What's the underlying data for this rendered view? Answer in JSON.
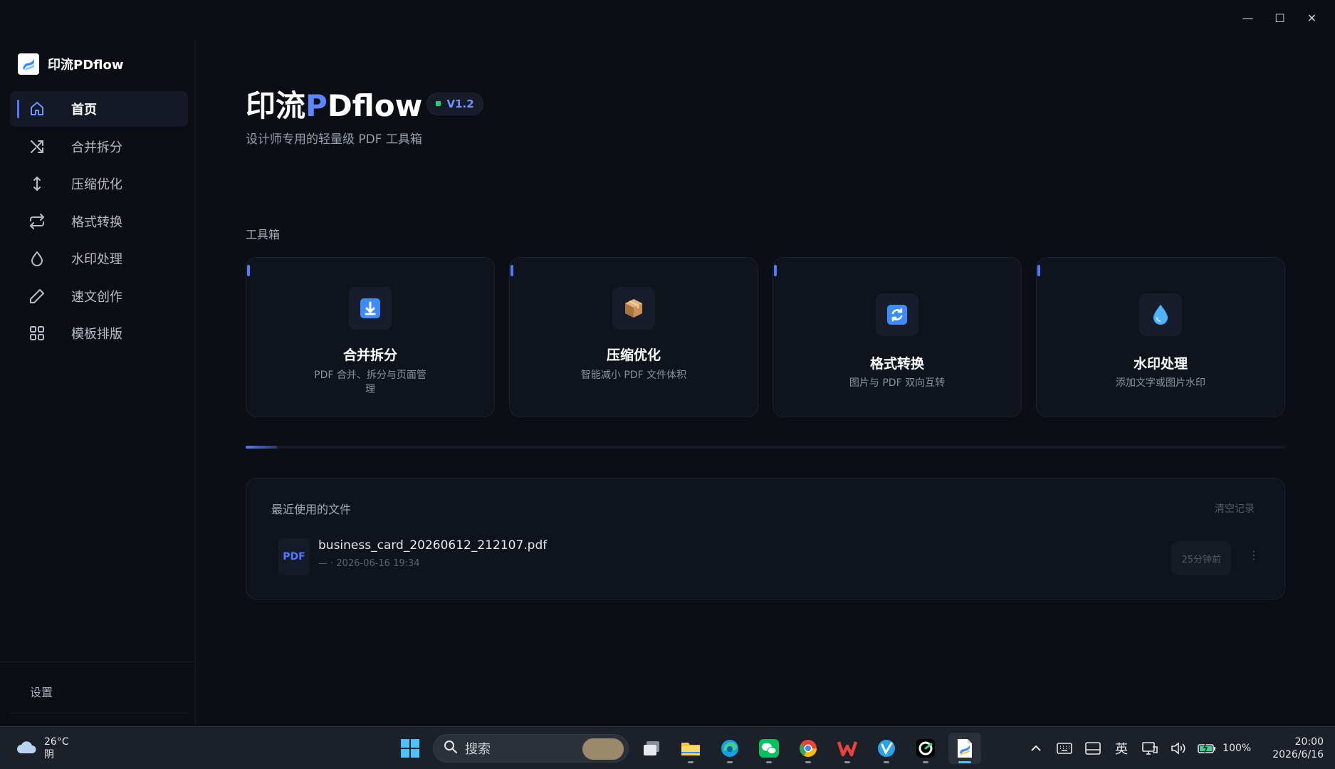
{
  "window": {
    "minimize": "—",
    "maximize": "☐",
    "close": "✕"
  },
  "sidebar": {
    "brand": "印流PDflow",
    "items": [
      {
        "label": "首页",
        "icon": "home-icon",
        "active": true
      },
      {
        "label": "合并拆分",
        "icon": "shuffle-icon"
      },
      {
        "label": "压缩优化",
        "icon": "updown-arrow-icon"
      },
      {
        "label": "格式转换",
        "icon": "repeat-icon"
      },
      {
        "label": "水印处理",
        "icon": "droplet-icon"
      },
      {
        "label": "速文创作",
        "icon": "pencil-icon"
      },
      {
        "label": "模板排版",
        "icon": "grid-icon"
      }
    ],
    "settings": "设置"
  },
  "header": {
    "title_part1": "印流",
    "title_accent": "P",
    "title_part2": "Dflow",
    "version": "V1.2",
    "subtitle": "设计师专用的轻量级 PDF 工具箱"
  },
  "toolbox": {
    "label": "工具箱",
    "cards": [
      {
        "title": "合并拆分",
        "desc": "PDF 合并、拆分与页面管理",
        "icon": "download-box-icon"
      },
      {
        "title": "压缩优化",
        "desc": "智能减小 PDF 文件体积",
        "icon": "package-icon"
      },
      {
        "title": "格式转换",
        "desc": "图片与 PDF 双向互转",
        "icon": "refresh-icon"
      },
      {
        "title": "水印处理",
        "desc": "添加文字或图片水印",
        "icon": "droplet-icon"
      }
    ]
  },
  "progress": {
    "fraction": 0.03
  },
  "recent": {
    "title": "最近使用的文件",
    "clear": "清空记录",
    "files": [
      {
        "badge": "PDF",
        "name": "business_card_20260612_212107.pdf",
        "meta": "— · 2026-06-16 19:34",
        "time": "25分钟前",
        "more": "⋮"
      }
    ]
  },
  "taskbar": {
    "temp": "26°C",
    "weather": "阴",
    "search_placeholder": "搜索",
    "lang": "英",
    "battery": "100%",
    "time": "20:00",
    "date": "2026/6/16"
  },
  "colors": {
    "accent": "#4f7cff",
    "background": "#0b0e14",
    "card": "#0f131b",
    "version_dot": "#2ecc71"
  }
}
